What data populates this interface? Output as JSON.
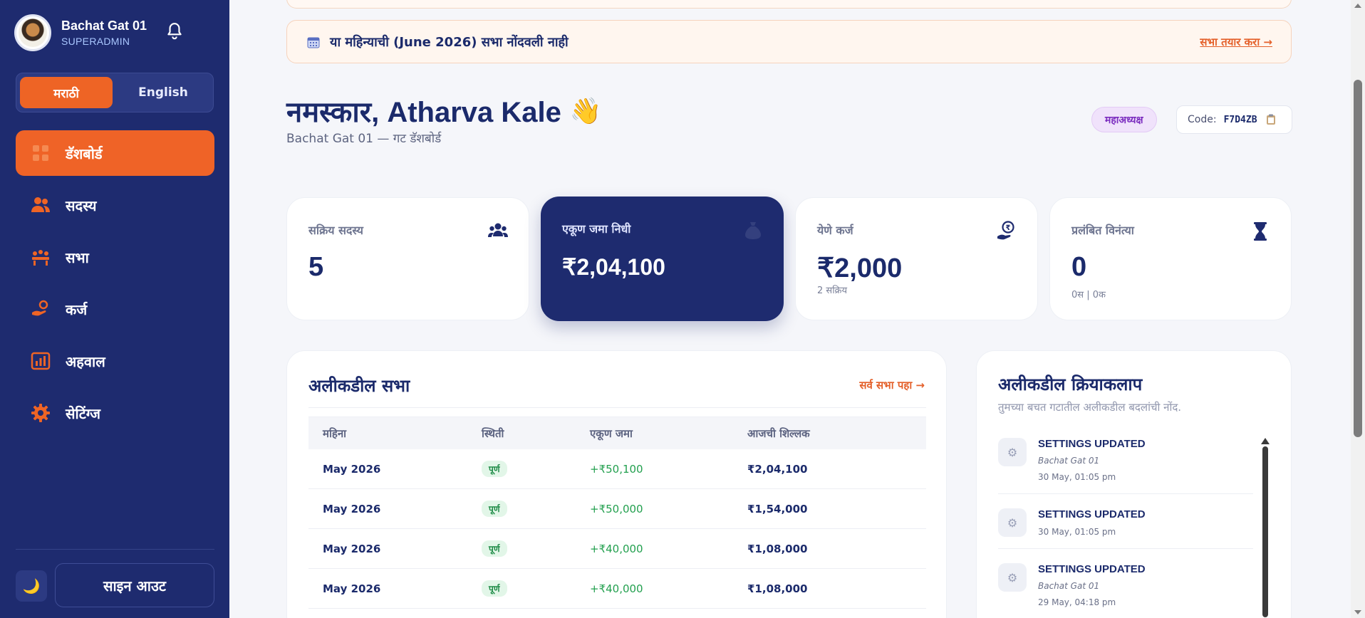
{
  "sidebar": {
    "brand_name": "Bachat Gat 01",
    "brand_role": "SUPERADMIN",
    "lang_options": [
      "मराठी",
      "English"
    ],
    "nav": [
      {
        "label": "डॅशबोर्ड",
        "icon": "dashboard-icon",
        "active": true
      },
      {
        "label": "सदस्य",
        "icon": "members-icon"
      },
      {
        "label": "सभा",
        "icon": "meeting-icon"
      },
      {
        "label": "कर्ज",
        "icon": "loan-icon"
      },
      {
        "label": "अहवाल",
        "icon": "report-icon"
      },
      {
        "label": "सेटिंग्ज",
        "icon": "settings-icon"
      }
    ],
    "theme_icon": "🌙",
    "signout_label": "साइन आउट"
  },
  "alert": {
    "text": "या महिन्याची (June 2026) सभा नोंदवली नाही",
    "link": "सभा तयार करा →"
  },
  "header": {
    "greeting": "नमस्कार, Atharva Kale",
    "wave": "👋",
    "subtitle": "Bachat Gat 01 — गट डॅशबोर्ड",
    "role_badge": "महाअध्यक्ष",
    "code_label": "Code:",
    "code_value": "F7D4ZB"
  },
  "stats": [
    {
      "label": "सक्रिय सदस्य",
      "value": "5",
      "sub": "",
      "icon": "members-icon"
    },
    {
      "label": "एकूण जमा निधी",
      "value": "₹2,04,100",
      "sub": "",
      "icon": "money-bag-icon"
    },
    {
      "label": "येणे कर्ज",
      "value": "₹2,000",
      "sub": "2 सक्रिय",
      "icon": "rupee-hand-icon"
    },
    {
      "label": "प्रलंबित विनंत्या",
      "value": "0",
      "sub": "0स | 0क",
      "icon": "hourglass-icon"
    }
  ],
  "meetings": {
    "title": "अलीकडील सभा",
    "link": "सर्व सभा पहा →",
    "columns": [
      "महिना",
      "स्थिती",
      "एकूण जमा",
      "आजची शिल्लक"
    ],
    "rows": [
      {
        "month": "May 2026",
        "status": "पूर्ण",
        "collected": "+₹50,100",
        "balance": "₹2,04,100"
      },
      {
        "month": "May 2026",
        "status": "पूर्ण",
        "collected": "+₹50,000",
        "balance": "₹1,54,000"
      },
      {
        "month": "May 2026",
        "status": "पूर्ण",
        "collected": "+₹40,000",
        "balance": "₹1,08,000"
      },
      {
        "month": "May 2026",
        "status": "पूर्ण",
        "collected": "+₹40,000",
        "balance": "₹1,08,000"
      }
    ]
  },
  "activity": {
    "title": "अलीकडील क्रियाकलाप",
    "subtitle": "तुमच्या बचत गटातील अलीकडील बदलांची नोंद.",
    "items": [
      {
        "title": "SETTINGS UPDATED",
        "group": "Bachat Gat 01",
        "time": "30 May, 01:05 pm"
      },
      {
        "title": "SETTINGS UPDATED",
        "group": "",
        "time": "30 May, 01:05 pm"
      },
      {
        "title": "SETTINGS UPDATED",
        "group": "Bachat Gat 01",
        "time": "29 May, 04:18 pm"
      }
    ]
  },
  "colors": {
    "sidebar": "#1e2b6f",
    "accent": "#ee6425",
    "text": "#1b2a6b",
    "success": "#23a04f"
  }
}
